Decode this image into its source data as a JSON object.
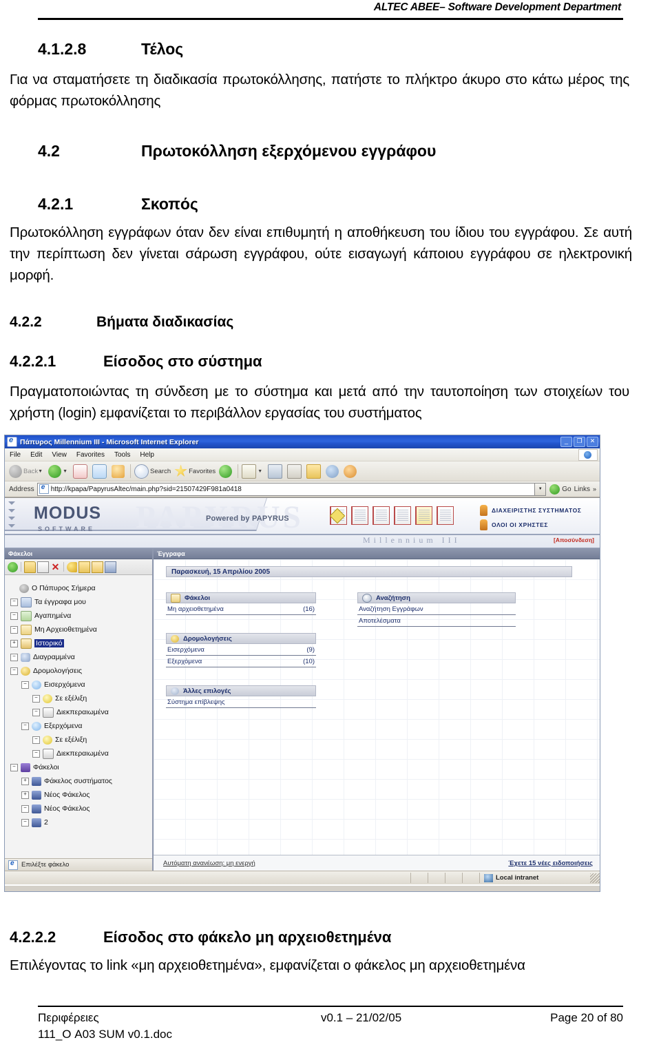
{
  "page_header": "ALTEC ABEE– Software Development Department",
  "sections": [
    {
      "number": "4.1.2.8",
      "title": "Τέλος",
      "body": "Για να σταματήσετε τη διαδικασία πρωτοκόλλησης, πατήστε το πλήκτρο άκυρο στο κάτω μέρος της φόρμας πρωτοκόλλησης"
    },
    {
      "number": "4.2",
      "title": "Πρωτοκόλληση εξερχόμενου εγγράφου",
      "body": ""
    },
    {
      "number": "4.2.1",
      "title": "Σκοπός",
      "body": "Πρωτοκόλληση εγγράφων όταν δεν είναι επιθυμητή η αποθήκευση του ίδιου του εγγράφου. Σε αυτή την περίπτωση δεν γίνεται σάρωση εγγράφου, ούτε εισαγωγή κάποιου εγγράφου σε ηλεκτρονική μορφή."
    },
    {
      "number": "4.2.2",
      "title": "Βήματα διαδικασίας",
      "body": ""
    },
    {
      "number": "4.2.2.1",
      "title": "Είσοδος στο σύστημα",
      "body": "Πραγματοποιώντας τη σύνδεση με το σύστημα και μετά από την ταυτοποίηση των στοιχείων του χρήστη (login) εμφανίζεται το περιβάλλον εργασίας του συστήματος"
    },
    {
      "number": "4.2.2.2",
      "title": "Είσοδος στο φάκελο μη αρχειοθετημένα",
      "body": "Επιλέγοντας το link «μη αρχειοθετημένα», εμφανίζεται ο φάκελος μη αρχειοθετημένα"
    }
  ],
  "screenshot": {
    "window_title": "Πάπυρος Millennium III - Microsoft Internet Explorer",
    "window_buttons": [
      "_",
      "❐",
      "✕"
    ],
    "menu": [
      "File",
      "Edit",
      "View",
      "Favorites",
      "Tools",
      "Help"
    ],
    "toolbar": [
      {
        "name": "back",
        "label": "Back"
      },
      {
        "name": "forward",
        "label": ""
      },
      {
        "name": "stop",
        "label": ""
      },
      {
        "name": "refresh",
        "label": ""
      },
      {
        "name": "home",
        "label": ""
      },
      {
        "name": "search",
        "label": "Search"
      },
      {
        "name": "favorites",
        "label": "Favorites"
      },
      {
        "name": "media",
        "label": ""
      },
      {
        "name": "mail",
        "label": ""
      },
      {
        "name": "print",
        "label": ""
      },
      {
        "name": "edit",
        "label": ""
      },
      {
        "name": "folder",
        "label": ""
      },
      {
        "name": "discuss",
        "label": ""
      },
      {
        "name": "messenger",
        "label": ""
      }
    ],
    "address": {
      "label": "Address",
      "url": "http://kpapa/PapyrusAltec/main.php?sid=21507429F981a0418",
      "go_label": "Go",
      "links_label": "Links"
    },
    "banner": {
      "watermark": "PAPYRUS",
      "logo": "MODUS",
      "logo_sub": "SOFTWARE",
      "powered_by": "Powered by PAPYRUS",
      "admin_label": "ΔΙΑΧΕΙΡΙΣΤΗΣ ΣΥΣΤΗΜΑΤΟΣ",
      "allusers_label": "ΟΛΟΙ ΟΙ ΧΡΗΣΤΕΣ",
      "product": "Millennium III",
      "logout": "[Αποσύνδεση]"
    },
    "left_pane": {
      "title": "Φάκελοι",
      "toolbar_icons": [
        "refresh-icon",
        "new-folder-icon",
        "rename-icon",
        "delete-icon",
        "key-icon",
        "folder-lock-icon",
        "folder-open-icon",
        "save-icon"
      ],
      "tree": [
        {
          "label": "Ο Πάπυρος Σήμερα",
          "indent": 0,
          "expander": "",
          "icon": "gear",
          "selected": false
        },
        {
          "label": "Τα έγγραφα μου",
          "indent": 0,
          "expander": "−",
          "icon": "folderb",
          "selected": false
        },
        {
          "label": "Αγαπημένα",
          "indent": 0,
          "expander": "−",
          "icon": "folderg",
          "selected": false
        },
        {
          "label": "Μη Αρχειοθετημένα",
          "indent": 0,
          "expander": "−",
          "icon": "folder",
          "selected": false
        },
        {
          "label": "Ιστορικό",
          "indent": 0,
          "expander": "+",
          "icon": "hist",
          "selected": true
        },
        {
          "label": "Διαγραμμένα",
          "indent": 0,
          "expander": "−",
          "icon": "trash",
          "selected": false
        },
        {
          "label": "Δρομολογήσεις",
          "indent": 0,
          "expander": "−",
          "icon": "route",
          "selected": false
        },
        {
          "label": "Εισερχόμενα",
          "indent": 1,
          "expander": "−",
          "icon": "inbox",
          "selected": false
        },
        {
          "label": "Σε εξέλιξη",
          "indent": 2,
          "expander": "−",
          "icon": "prog",
          "selected": false
        },
        {
          "label": "Διεκπεραιωμένα",
          "indent": 2,
          "expander": "−",
          "icon": "flag",
          "selected": false
        },
        {
          "label": "Εξερχόμενα",
          "indent": 1,
          "expander": "−",
          "icon": "inbox",
          "selected": false
        },
        {
          "label": "Σε εξέλιξη",
          "indent": 2,
          "expander": "−",
          "icon": "prog",
          "selected": false
        },
        {
          "label": "Διεκπεραιωμένα",
          "indent": 2,
          "expander": "−",
          "icon": "flag",
          "selected": false
        },
        {
          "label": "Φάκελοι",
          "indent": 0,
          "expander": "−",
          "icon": "folders",
          "selected": false
        },
        {
          "label": "Φάκελος συστήματος",
          "indent": 1,
          "expander": "+",
          "icon": "fsys",
          "selected": false
        },
        {
          "label": "Νέος Φάκελος",
          "indent": 1,
          "expander": "+",
          "icon": "fsys",
          "selected": false
        },
        {
          "label": "Νέος Φάκελος",
          "indent": 1,
          "expander": "−",
          "icon": "fsys",
          "selected": false
        },
        {
          "label": "2",
          "indent": 1,
          "expander": "−",
          "icon": "fsys",
          "selected": false
        }
      ],
      "status": "Επιλέξτε φάκελο"
    },
    "right_pane": {
      "title": "Έγγραφα",
      "date": "Παρασκευή, 15 Απριλίου 2005",
      "groups_left": [
        {
          "icon": "folder",
          "heading": "Φάκελοι",
          "links": [
            {
              "label": "Μη αρχειοθετημένα",
              "count": "(16)"
            }
          ]
        },
        {
          "icon": "route",
          "heading": "Δρομολογήσεις",
          "links": [
            {
              "label": "Εισερχόμενα",
              "count": "(9)"
            },
            {
              "label": "Εξερχόμενα",
              "count": "(10)"
            }
          ]
        },
        {
          "icon": "other",
          "heading": "Άλλες επιλογές",
          "links": [
            {
              "label": "Σύστημα επίβλεψης",
              "count": ""
            }
          ]
        }
      ],
      "groups_right": [
        {
          "icon": "search",
          "heading": "Αναζήτηση",
          "links": [
            {
              "label": "Αναζήτηση Εγγράφων",
              "count": ""
            },
            {
              "label": "Αποτελέσματα",
              "count": ""
            }
          ]
        }
      ],
      "footer_left": "Αυτόματη ανανέωση: μη ενεργή",
      "footer_right": "Έχετε 15 νέες ειδοποιήσεις"
    },
    "status_bar": {
      "text": "",
      "zone": "Local intranet"
    }
  },
  "footer": {
    "left_line1": "Περιφέρειες",
    "left_line2": "111_Ο A03 SUM v0.1.doc",
    "center": "v0.1 – 21/02/05",
    "right": "Page 20 of 80"
  }
}
